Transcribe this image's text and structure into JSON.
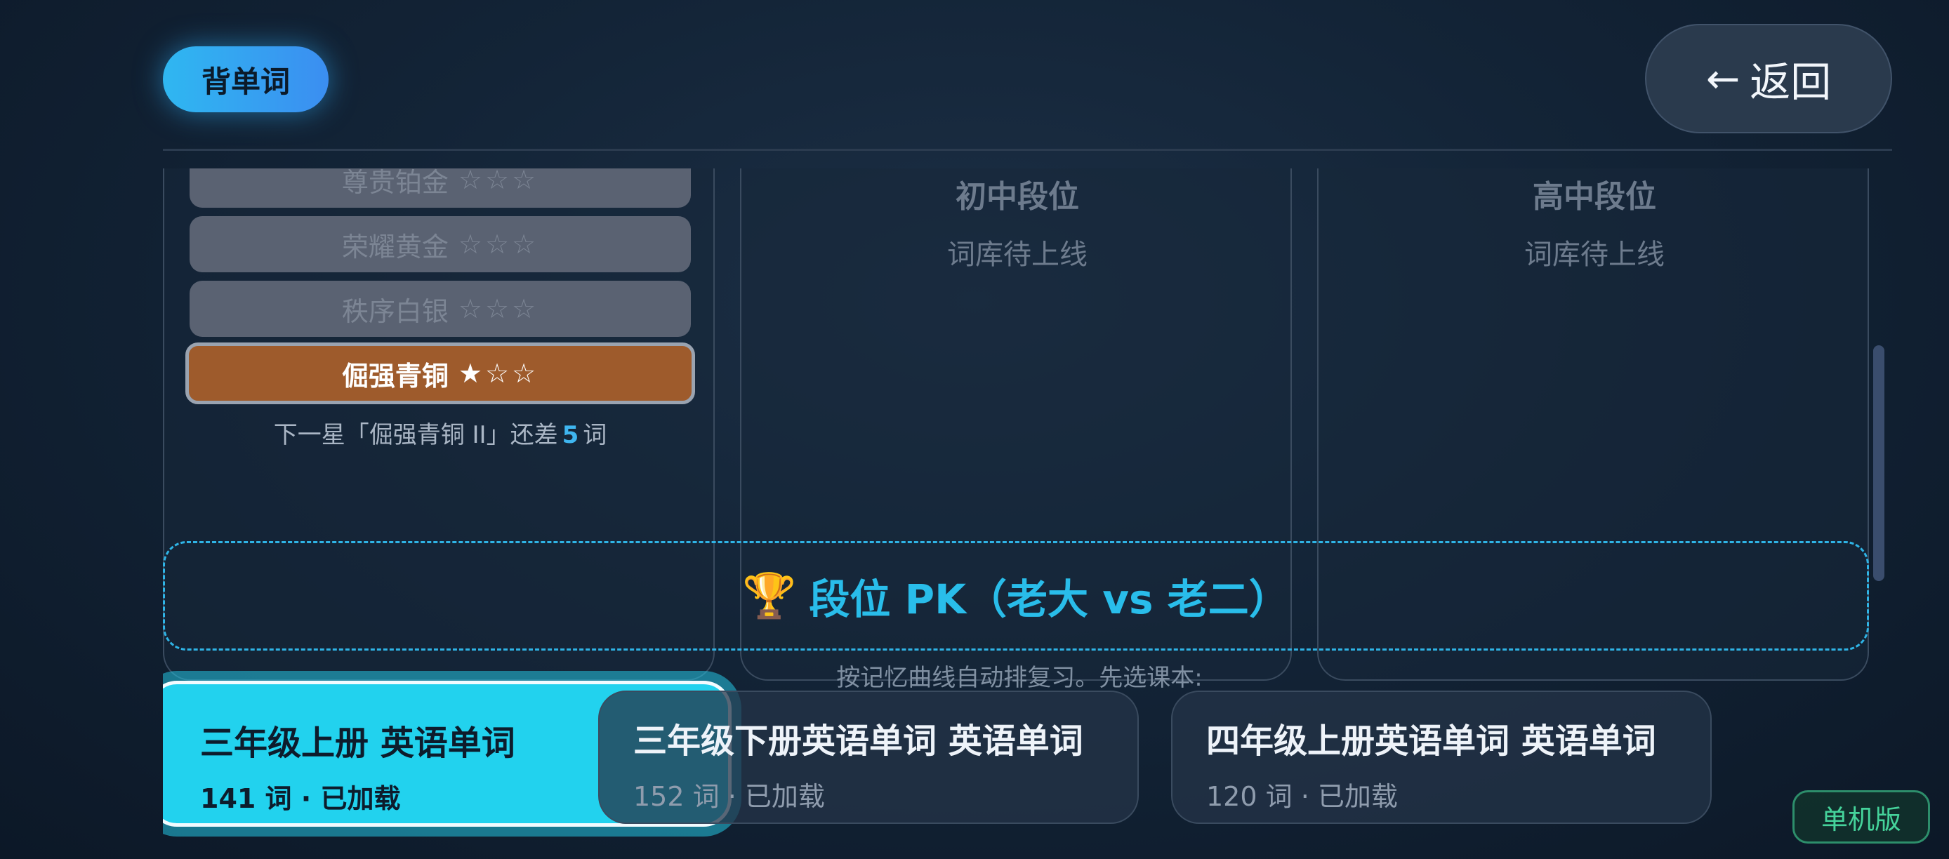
{
  "header": {
    "app_badge": "背单词",
    "back_label": "返回",
    "back_arrow": "←"
  },
  "rank_cards": {
    "primary": {
      "tiers": [
        {
          "label": "",
          "stars": "",
          "state": "locked"
        },
        {
          "label": "尊贵铂金",
          "stars": "☆☆☆",
          "state": "locked"
        },
        {
          "label": "荣耀黄金",
          "stars": "☆☆☆",
          "state": "locked"
        },
        {
          "label": "秩序白银",
          "stars": "☆☆☆",
          "state": "locked"
        },
        {
          "label": "倔强青铜",
          "stars": "★☆☆",
          "state": "active"
        }
      ],
      "next_star": {
        "prefix": "下一星「倔强青铜 II」还差",
        "count": "5",
        "suffix": "词"
      }
    },
    "middle": {
      "title": "初中段位",
      "subtitle": "词库待上线"
    },
    "high": {
      "title": "高中段位",
      "subtitle": "词库待上线"
    }
  },
  "pk": {
    "icon": "trophy-icon",
    "glyph": "🏆",
    "label": "段位 PK（老大 vs 老二）"
  },
  "hint": "按记忆曲线自动排复习。先选课本:",
  "books": [
    {
      "title": "三年级上册 英语单词",
      "meta": "141 词 · 已加载",
      "selected": true
    },
    {
      "title": "三年级下册英语单词 英语单词",
      "meta": "152 词 · 已加载",
      "selected": false
    },
    {
      "title": "四年级上册英语单词 英语单词",
      "meta": "120 词 · 已加载",
      "selected": false
    }
  ],
  "footer": {
    "offline_badge": "单机版"
  },
  "colors": {
    "accent_cyan": "#22d2ee",
    "bronze": "#9e5b2c",
    "badge_blue": "#2fb7f1",
    "offline_green": "#45d39b"
  }
}
